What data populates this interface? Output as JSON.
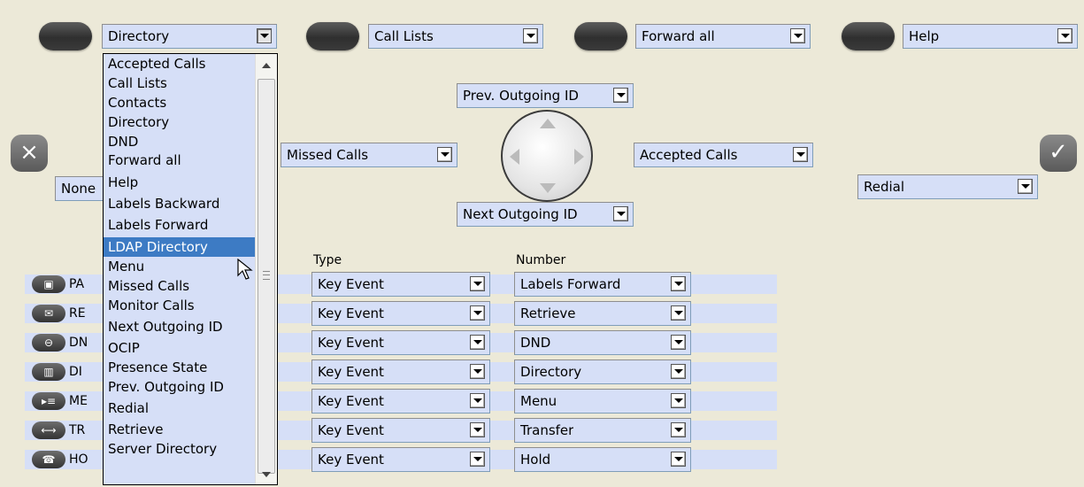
{
  "top_keys": [
    {
      "value": "Directory"
    },
    {
      "value": "Call Lists"
    },
    {
      "value": "Forward all"
    },
    {
      "value": "Help"
    }
  ],
  "nav": {
    "up": "Prev. Outgoing ID",
    "down": "Next Outgoing ID",
    "left": "Missed Calls",
    "right": "Accepted Calls"
  },
  "left_button_select": "None",
  "right_button_select": "Redial",
  "dropdown": {
    "options": [
      "Accepted Calls",
      "Call Lists",
      "Contacts",
      "Directory",
      "DND",
      "Forward all",
      "Help",
      "Labels Backward",
      "Labels Forward",
      "LDAP Directory",
      "Menu",
      "Missed Calls",
      "Monitor Calls",
      "Next Outgoing ID",
      "OCIP",
      "Presence State",
      "Prev. Outgoing ID",
      "Redial",
      "Retrieve",
      "Server Directory"
    ],
    "highlighted": "LDAP Directory"
  },
  "columns": {
    "type": "Type",
    "number": "Number"
  },
  "rows": [
    {
      "label": "PA",
      "icon": "page-icon",
      "type": "Key Event",
      "number": "Labels Forward"
    },
    {
      "label": "RE",
      "icon": "envelope-icon",
      "type": "Key Event",
      "number": "Retrieve"
    },
    {
      "label": "DN",
      "icon": "no-entry-icon",
      "type": "Key Event",
      "number": "DND"
    },
    {
      "label": "DI",
      "icon": "book-icon",
      "type": "Key Event",
      "number": "Directory"
    },
    {
      "label": "ME",
      "icon": "menu-icon",
      "type": "Key Event",
      "number": "Menu"
    },
    {
      "label": "TR",
      "icon": "transfer-icon",
      "type": "Key Event",
      "number": "Transfer"
    },
    {
      "label": "HO",
      "icon": "hold-icon",
      "type": "Key Event",
      "number": "Hold"
    }
  ]
}
